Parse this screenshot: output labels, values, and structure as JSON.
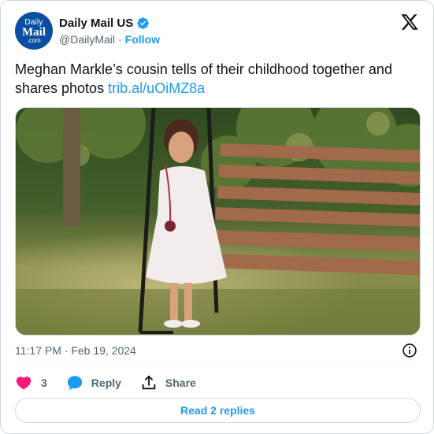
{
  "author": {
    "avatar_line1": "Daily",
    "avatar_line2": "Mail",
    "avatar_line3": ".com",
    "display_name": "Daily Mail US",
    "handle": "@DailyMail",
    "separator": "·",
    "follow_label": "Follow",
    "verified_color": "#1d9bf0",
    "avatar_color": "#0a4ea3"
  },
  "platform": {
    "logo_icon": "x-logo-icon"
  },
  "tweet": {
    "text": "Meghan Markle’s cousin tells of their childhood together and shares photos ",
    "link": "trib.al/uOiMZ8a",
    "media_icon": "photo-child-on-swing"
  },
  "meta": {
    "timestamp": "11:17 PM · Feb 19, 2024",
    "info_icon": "info-icon"
  },
  "actions": {
    "like_count": "3",
    "like_color": "#f91880",
    "reply_label": "Reply",
    "reply_color": "#1d9bf0",
    "share_label": "Share"
  },
  "read_replies_label": "Read 2 replies",
  "colors": {
    "accent": "#1d9bf0",
    "secondary_text": "#536471",
    "border": "#cfd9de"
  }
}
